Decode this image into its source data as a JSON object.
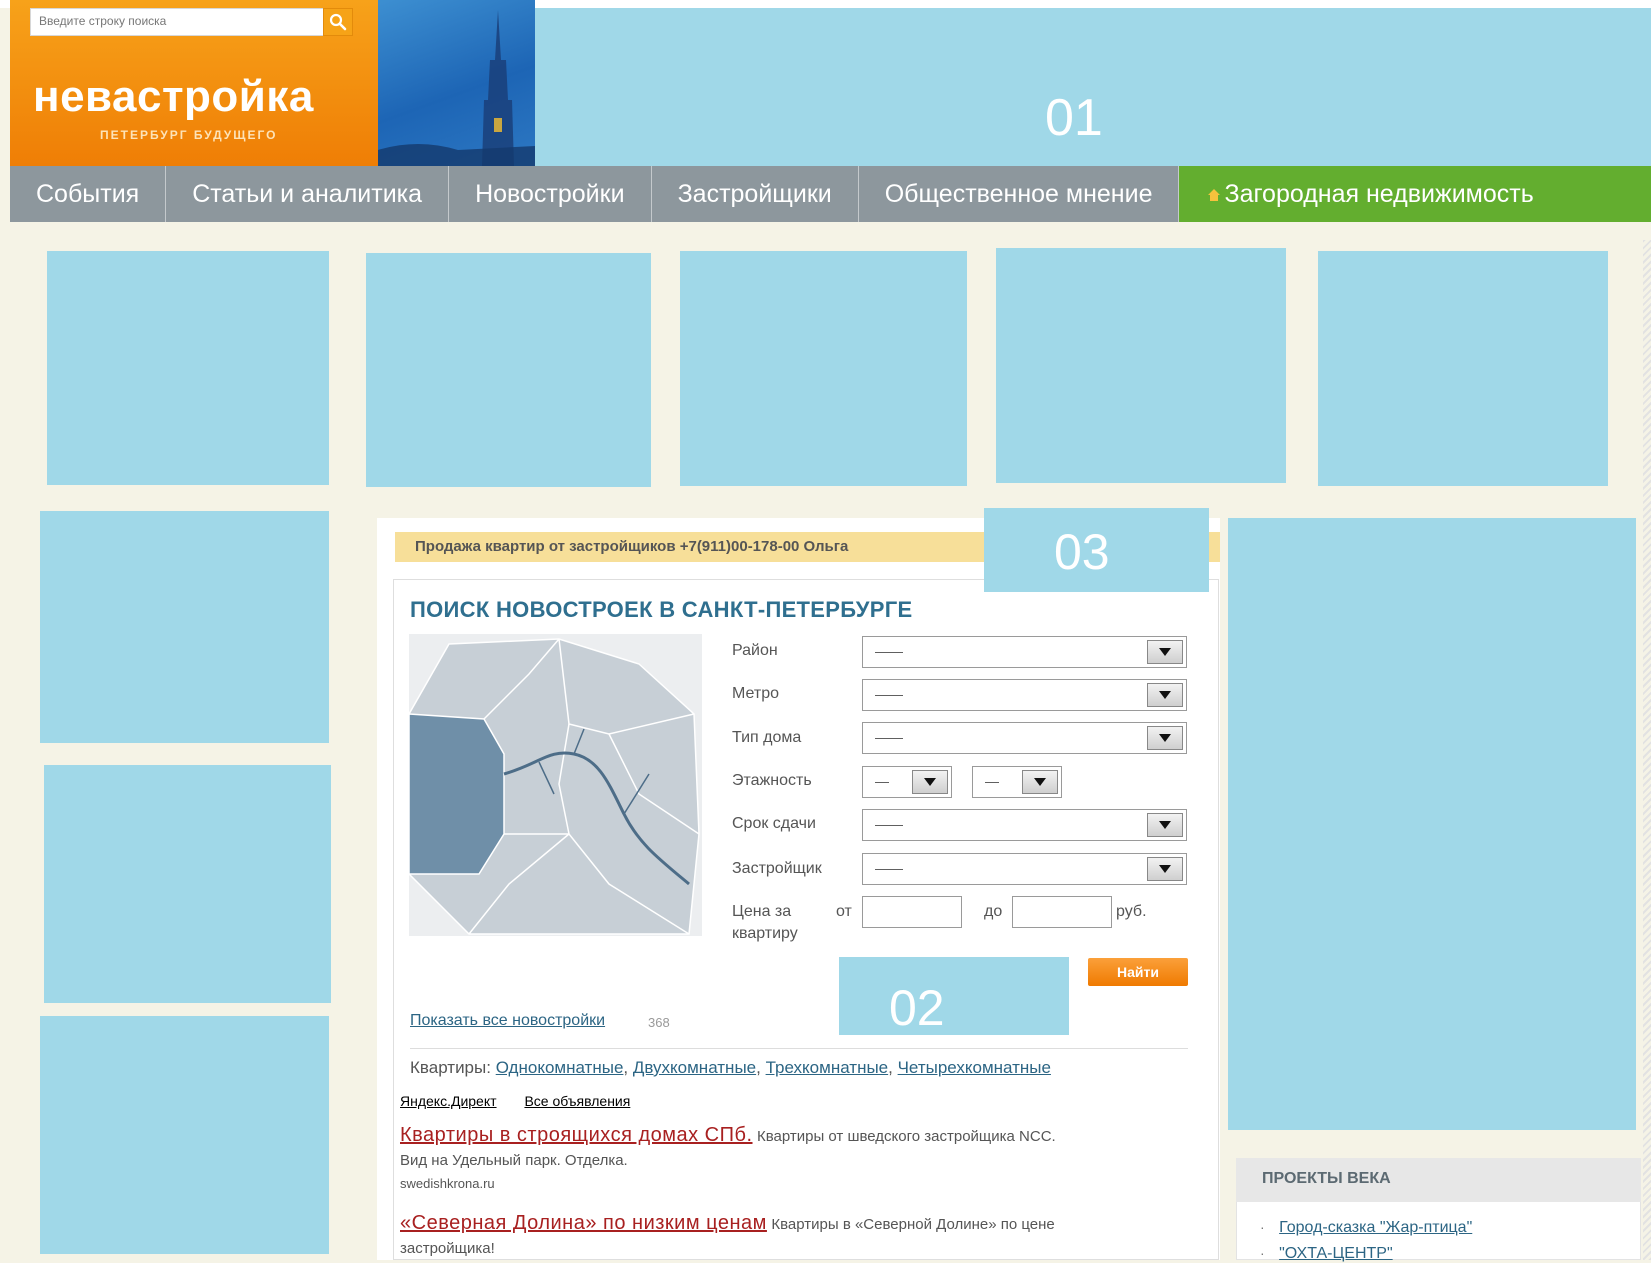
{
  "header": {
    "search_placeholder": "Введите строку поиска",
    "logo_text": "невастройка",
    "logo_subtitle": "ПЕТЕРБУРГ БУДУЩЕГО",
    "banner_01_label": "01"
  },
  "nav": {
    "items": [
      "События",
      "Статьи и аналитика",
      "Новостройки",
      "Застройщики",
      "Общественное мнение"
    ],
    "country_item": "Загородная недвижимость"
  },
  "promo": {
    "text": "Продажа квартир от застройщиков  +7(911)00-178-00  Ольга",
    "banner_03_label": "03"
  },
  "search_form": {
    "title": "ПОИСК НОВОСТРОЕК В САНКТ-ПЕТЕРБУРГЕ",
    "district_label": "Район",
    "district_value": "——",
    "metro_label": "Метро",
    "metro_value": "——",
    "house_type_label": "Тип дома",
    "house_type_value": "——",
    "floors_label": "Этажность",
    "floors_from_value": "—",
    "floors_to_value": "—",
    "deadline_label": "Срок сдачи",
    "deadline_value": "——",
    "developer_label": "Застройщик",
    "developer_value": "——",
    "price_label_1": "Цена за",
    "price_label_2": "квартиру",
    "price_from": "от",
    "price_to": "до",
    "price_currency": "руб.",
    "find_button": "Найти",
    "banner_02_label": "02",
    "show_all_link": "Показать все новостройки",
    "show_all_count": "368",
    "apartments_prefix": "Квартиры:",
    "apartment_types": [
      "Однокомнатные",
      "Двухкомнатные",
      "Трехкомнатные",
      "Четырехкомнатные"
    ]
  },
  "direct_ads": {
    "yandex_direct": "Яндекс.Директ",
    "all_ads": "Все объявления",
    "ads": [
      {
        "title": "Квартиры в строящихся домах СПб.",
        "body_1": "Квартиры от шведского застройщика NCC.",
        "body_2": "Вид на Удельный парк. Отделка.",
        "domain": "swedishkrona.ru"
      },
      {
        "title": "«Северная Долина» по низким ценам",
        "body_1": "Квартиры в «Северной Долине» по цене",
        "body_2": "застройщика!"
      }
    ]
  },
  "projects": {
    "title": "ПРОЕКТЫ ВЕКА",
    "items": [
      "Город-сказка \"Жар-птица\"",
      "\"ОХТА-ЦЕНТР\""
    ]
  },
  "colors": {
    "ad_placeholder": "#a0d8e8",
    "logo_orange": "#f7a21a",
    "nav_gray": "#8d979d",
    "nav_green": "#63ae2f",
    "link_blue": "#2c6584",
    "ad_title_red": "#a82020"
  },
  "icons": [
    "search-icon",
    "house-icon",
    "dropdown-arrow-icon",
    "map-image"
  ]
}
